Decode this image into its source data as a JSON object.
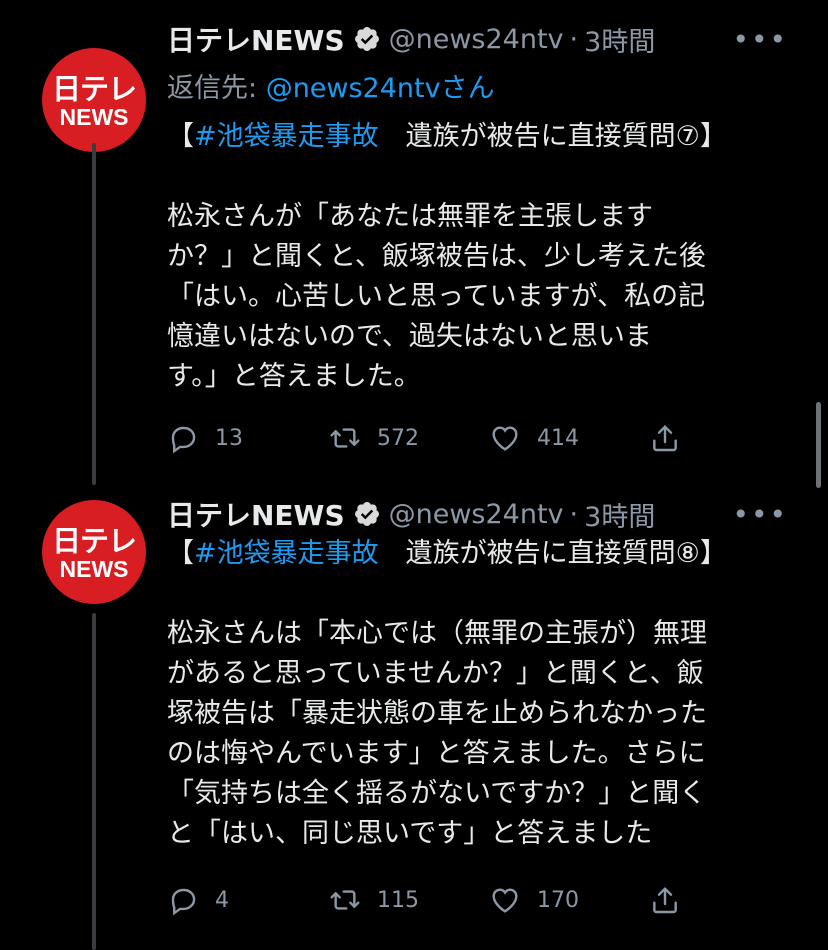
{
  "tweets": [
    {
      "avatar": {
        "logo_top": "日テレ",
        "logo_bottom": "NEWS"
      },
      "name": "日テレNEWS",
      "handle": "@news24ntv",
      "separator": "·",
      "time": "3時間",
      "reply_prefix": "返信先: ",
      "reply_mention": "@news24ntvさん",
      "hashtag_line": {
        "open": "【",
        "hashtag": "#池袋暴走事故",
        "rest": "　遺族が被告に直接質問⑦】"
      },
      "lines": [
        "松永さんが「あなたは無罪を主張します",
        "か？」と聞くと、飯塚被告は、少し考えた後",
        "「はい。心苦しいと思っていますが、私の記",
        "憶違いはないので、過失はないと思いま",
        "す。」と答えました。"
      ],
      "counts": {
        "replies": "13",
        "retweets": "572",
        "likes": "414"
      }
    },
    {
      "avatar": {
        "logo_top": "日テレ",
        "logo_bottom": "NEWS"
      },
      "name": "日テレNEWS",
      "handle": "@news24ntv",
      "separator": "·",
      "time": "3時間",
      "hashtag_line": {
        "open": "【",
        "hashtag": "#池袋暴走事故",
        "rest": "　遺族が被告に直接質問⑧】"
      },
      "lines": [
        "松永さんは「本心では（無罪の主張が）無理",
        "があると思っていませんか？」と聞くと、飯",
        "塚被告は「暴走状態の車を止められなかった",
        "のは悔やんでいます」と答えました。さらに",
        "「気持ちは全く揺るがないですか？」と聞く",
        "と「はい、同じ思いです」と答えました"
      ],
      "counts": {
        "replies": "4",
        "retweets": "115",
        "likes": "170"
      }
    }
  ],
  "more_label": "•••",
  "colors": {
    "accent": "#1d9bf0",
    "secondary": "#8b98a5",
    "brand_red": "#d81e22"
  },
  "icons": [
    "verified-badge-icon",
    "reply-icon",
    "retweet-icon",
    "like-icon",
    "share-icon",
    "more-icon"
  ]
}
